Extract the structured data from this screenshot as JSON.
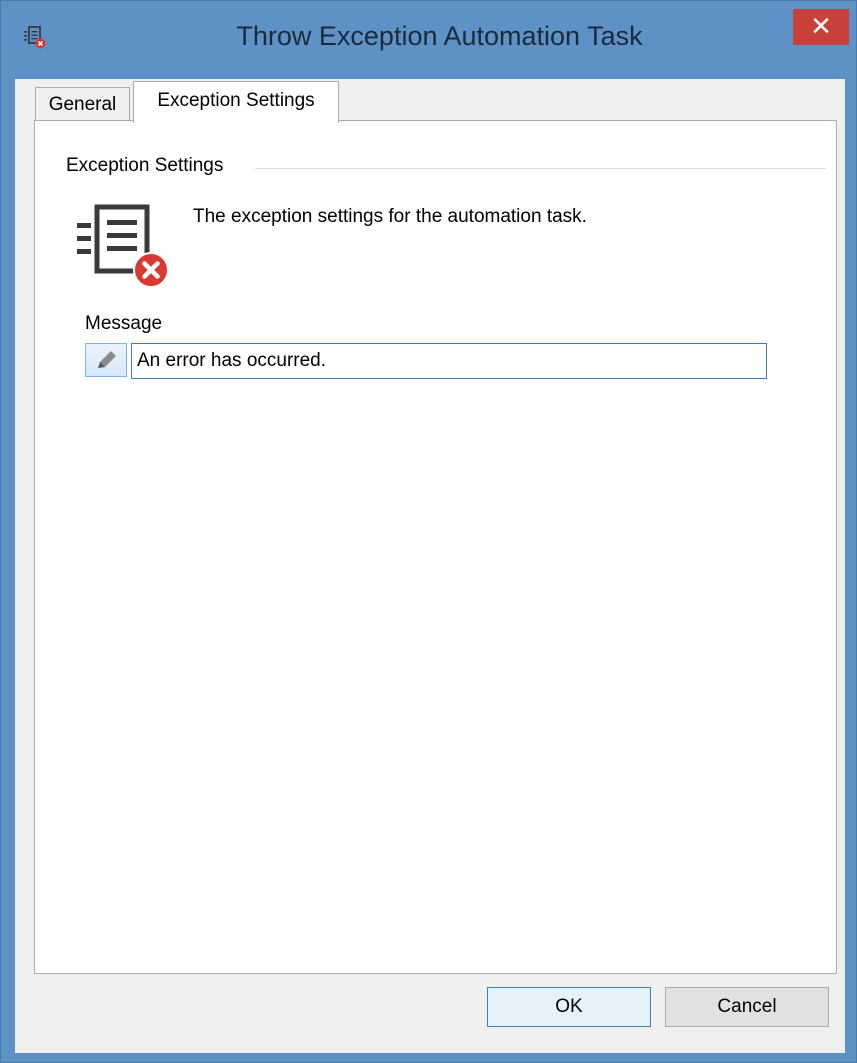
{
  "window": {
    "title": "Throw Exception Automation Task",
    "close_label": "✕",
    "icon": "task-error-icon"
  },
  "tabs": [
    {
      "label": "General",
      "active": false
    },
    {
      "label": "Exception Settings",
      "active": true
    }
  ],
  "exception_settings": {
    "group_title": "Exception Settings",
    "icon": "document-list-error-icon",
    "description": "The exception settings for the automation task.",
    "message_label": "Message",
    "message_value": "An error has occurred.",
    "edit_icon": "pencil-icon"
  },
  "buttons": {
    "ok_label": "OK",
    "cancel_label": "Cancel"
  },
  "colors": {
    "title_bar": "#5e92c7",
    "close_button": "#c7403a",
    "error_red": "#d83a32",
    "focus_border": "#3c7fb1"
  }
}
